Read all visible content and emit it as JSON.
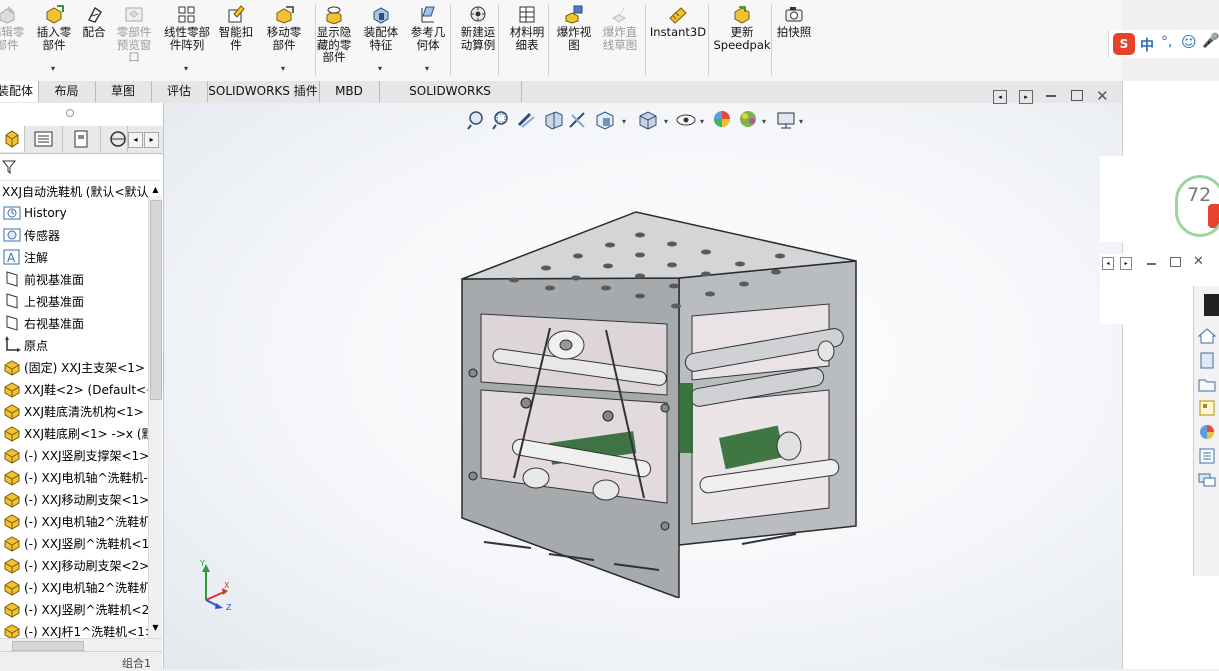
{
  "ribbon": {
    "buttons": [
      {
        "id": "edit-component",
        "label": "编辑零\n部件",
        "disabled": true,
        "dropdown": false
      },
      {
        "id": "insert-component",
        "label": "插入零\n部件",
        "disabled": false,
        "dropdown": true
      },
      {
        "id": "mate",
        "label": "配合",
        "disabled": false,
        "dropdown": false
      },
      {
        "id": "component-preview",
        "label": "零部件\n预览窗\n口",
        "disabled": true,
        "dropdown": false
      },
      {
        "id": "linear-pattern",
        "label": "线性零部\n件阵列",
        "disabled": false,
        "dropdown": true
      },
      {
        "id": "smart-fasteners",
        "label": "智能扣\n件",
        "disabled": false,
        "dropdown": false
      },
      {
        "id": "move-component",
        "label": "移动零\n部件",
        "disabled": false,
        "dropdown": true
      },
      {
        "id": "show-hidden",
        "label": "显示隐\n藏的零\n部件",
        "disabled": false,
        "dropdown": false
      },
      {
        "id": "assembly-features",
        "label": "装配体\n特征",
        "disabled": false,
        "dropdown": true
      },
      {
        "id": "reference-geometry",
        "label": "参考几\n何体",
        "disabled": false,
        "dropdown": true
      },
      {
        "id": "new-motion-study",
        "label": "新建运\n动算例",
        "disabled": false,
        "dropdown": false
      },
      {
        "id": "bill-of-materials",
        "label": "材料明\n细表",
        "disabled": false,
        "dropdown": false
      },
      {
        "id": "exploded-view",
        "label": "爆炸视\n图",
        "disabled": false,
        "dropdown": false
      },
      {
        "id": "explode-line-sketch",
        "label": "爆炸直\n线草图",
        "disabled": true,
        "dropdown": false
      },
      {
        "id": "instant3d",
        "label": "Instant3D",
        "disabled": false,
        "dropdown": false
      },
      {
        "id": "update-speedpak",
        "label": "更新\nSpeedpak",
        "disabled": false,
        "dropdown": false
      },
      {
        "id": "take-snapshot",
        "label": "拍快照",
        "disabled": false,
        "dropdown": false
      }
    ]
  },
  "tabs": [
    "装配体",
    "布局",
    "草图",
    "评估",
    "SOLIDWORKS 插件",
    "MBD",
    "SOLIDWORKS Inspection"
  ],
  "active_tab": 0,
  "ime": {
    "label": "中"
  },
  "score_badge": {
    "value": "72"
  },
  "tree": {
    "root": "XXJ自动洗鞋机  (默认<默认",
    "items": [
      {
        "label": "History",
        "icon": "history-icon"
      },
      {
        "label": "传感器",
        "icon": "sensor-icon"
      },
      {
        "label": "注解",
        "icon": "annotation-icon"
      },
      {
        "label": "前视基准面",
        "icon": "plane-icon"
      },
      {
        "label": "上视基准面",
        "icon": "plane-icon"
      },
      {
        "label": "右视基准面",
        "icon": "plane-icon"
      },
      {
        "label": "原点",
        "icon": "origin-icon"
      },
      {
        "label": "(固定) XXJ主支架<1>",
        "icon": "part-icon"
      },
      {
        "label": "XXJ鞋<2>  (Default<<",
        "icon": "part-icon"
      },
      {
        "label": "XXJ鞋底清洗机构<1>",
        "icon": "part-icon"
      },
      {
        "label": "XXJ鞋底刷<1>  ->x (默",
        "icon": "part-icon"
      },
      {
        "label": "(-) XXJ竖刷支撑架<1>",
        "icon": "part-icon"
      },
      {
        "label": "(-) XXJ电机轴^洗鞋机-",
        "icon": "part-icon"
      },
      {
        "label": "(-) XXJ移动刷支架<1>",
        "icon": "part-icon"
      },
      {
        "label": "(-) XXJ电机轴2^洗鞋机",
        "icon": "part-icon"
      },
      {
        "label": "(-) XXJ竖刷^洗鞋机<1",
        "icon": "part-icon"
      },
      {
        "label": "(-) XXJ移动刷支架<2>",
        "icon": "part-icon"
      },
      {
        "label": "(-) XXJ电机轴2^洗鞋机",
        "icon": "part-icon"
      },
      {
        "label": "(-) XXJ竖刷^洗鞋机<2",
        "icon": "part-icon"
      },
      {
        "label": "(-) XXJ杆1^洗鞋机<1>",
        "icon": "part-icon"
      }
    ],
    "status": "组合1"
  },
  "triad": {
    "x": "X",
    "y": "Y",
    "z": "Z"
  },
  "colors": {
    "accent": "#2a6ebb",
    "part": "#e8b400",
    "frame": "#8c8c8c"
  }
}
